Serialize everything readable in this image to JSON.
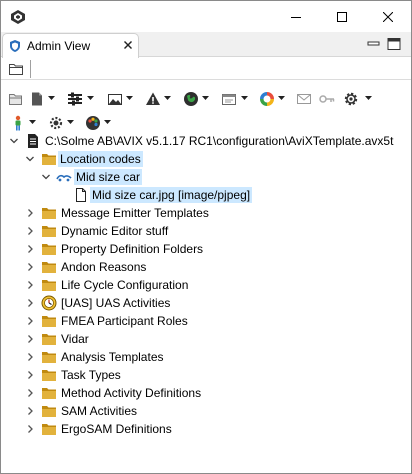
{
  "window": {
    "tab_label": "Admin View"
  },
  "colors": {
    "selection": "#cce8ff",
    "folder": "#d7a11a",
    "accent_blue": "#2a6ebb"
  },
  "toolbars": {
    "row1": [
      "folder-icon"
    ],
    "row2": [
      "open-folder-icon",
      "new-document-icon",
      "properties-icon",
      "image-icon",
      "warning-icon",
      "globe-icon",
      "window-icon",
      "color-wheel-icon",
      "mail-icon",
      "key-icon",
      "gear-icon"
    ],
    "row3": [
      "person-icon",
      "settings-icon",
      "palette-icon"
    ]
  },
  "tree": {
    "root": "C:\\Solme AB\\AVIX v5.1.17 RC1\\configuration\\AviXTemplate.avx5t",
    "location_codes": "Location codes",
    "mid_size_car": "Mid size car",
    "mid_size_car_file": "Mid size car.jpg [image/pjpeg]",
    "folders": [
      "Message Emitter Templates",
      "Dynamic Editor stuff",
      "Property Definition Folders",
      "Andon Reasons",
      "Life Cycle Configuration",
      "[UAS] UAS Activities",
      "FMEA Participant Roles",
      "Vidar",
      "Analysis Templates",
      "Task Types",
      "Method Activity Definitions",
      "SAM Activities",
      "ErgoSAM Definitions"
    ]
  }
}
